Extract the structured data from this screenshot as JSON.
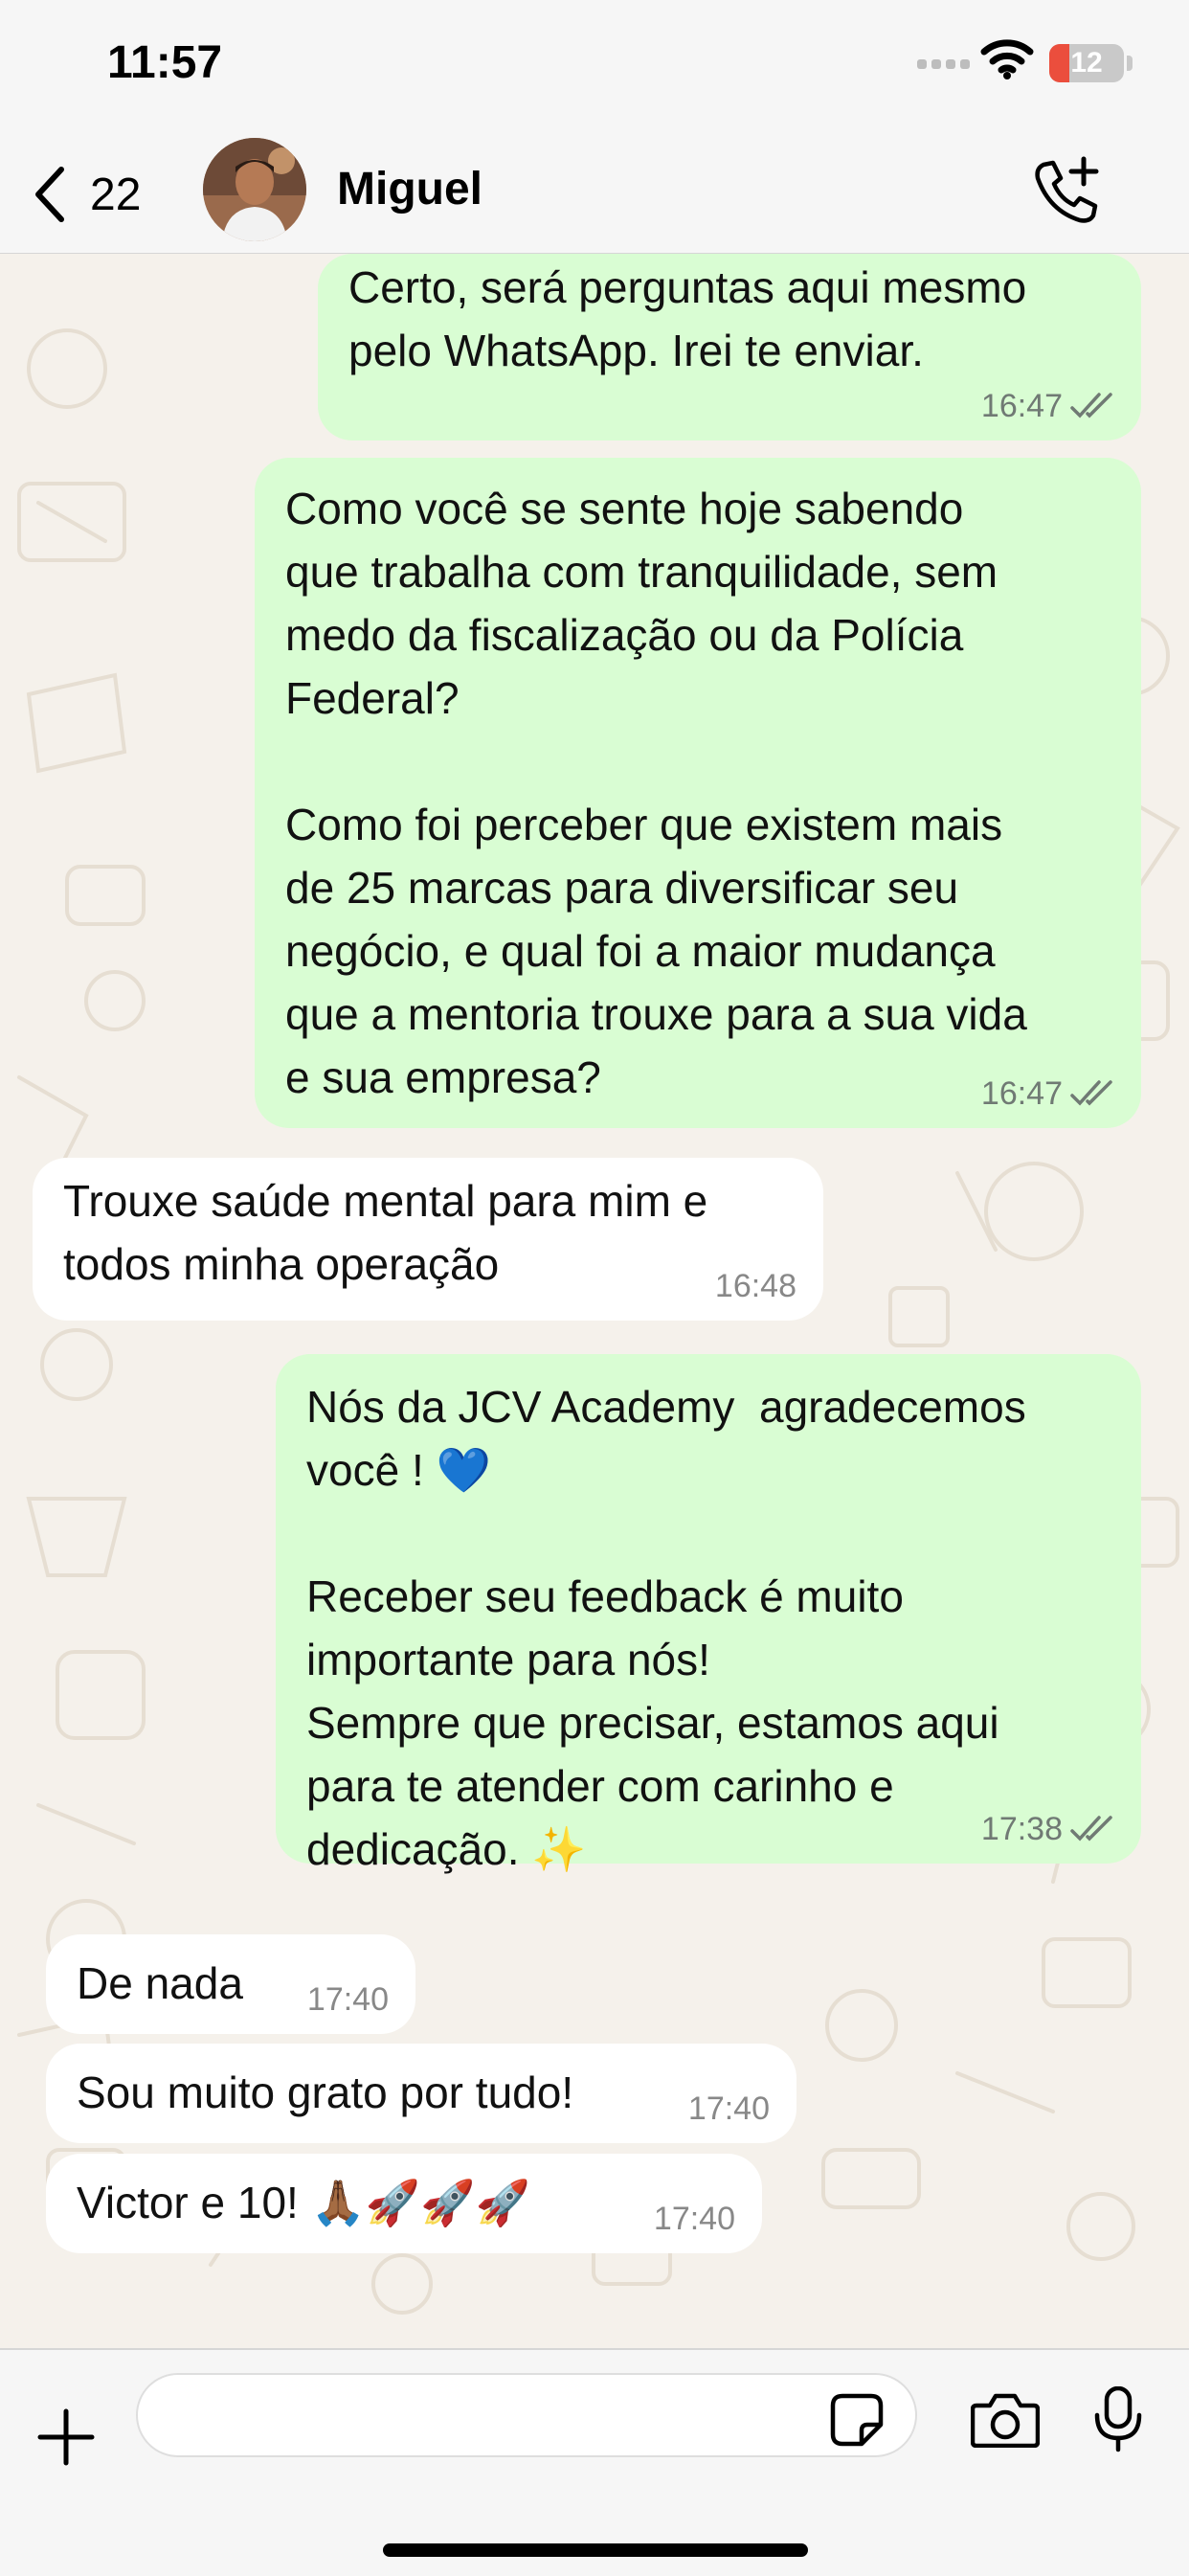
{
  "status": {
    "time": "11:57",
    "battery": "12",
    "battery_level": 0.12
  },
  "header": {
    "back_count": "22",
    "contact_name": "Miguel"
  },
  "messages": [
    {
      "direction": "out",
      "text": "Certo, será perguntas aqui mesmo\npelo WhatsApp. Irei te enviar.",
      "time": "16:47",
      "read": true
    },
    {
      "direction": "out",
      "text": "Como você se sente hoje sabendo\nque trabalha com tranquilidade, sem\nmedo da fiscalização ou da Polícia\nFederal?\n\nComo foi perceber que existem mais\nde 25 marcas para diversificar seu\nnegócio, e qual foi a maior mudança\nque a mentoria trouxe para a sua vida\ne sua empresa?",
      "time": "16:47",
      "read": true
    },
    {
      "direction": "in",
      "text": "Trouxe saúde mental para mim e\ntodos minha operação",
      "time": "16:48"
    },
    {
      "direction": "out",
      "text": "Nós da JCV Academy  agradecemos\nvocê ! 💙\n\nReceber seu feedback é muito\nimportante para nós!\nSempre que precisar, estamos aqui\npara te atender com carinho e\ndedicação. ✨",
      "time": "17:38",
      "read": true
    },
    {
      "direction": "in",
      "text": "De nada",
      "time": "17:40"
    },
    {
      "direction": "in",
      "text": "Sou muito grato por tudo!",
      "time": "17:40"
    },
    {
      "direction": "in",
      "text": "Victor e 10! 🙏🏾🚀🚀🚀",
      "time": "17:40"
    }
  ],
  "icons": {
    "back": "chevron-left-icon",
    "call_add": "phone-plus-icon",
    "attach": "plus-icon",
    "sticker": "sticker-icon",
    "camera": "camera-icon",
    "mic": "microphone-icon",
    "read_receipt": "double-check-icon"
  },
  "colors": {
    "outgoing_bubble": "#d9fdd3",
    "incoming_bubble": "#ffffff",
    "chat_background": "#f5f1eb",
    "battery_low": "#eb4e3d"
  }
}
